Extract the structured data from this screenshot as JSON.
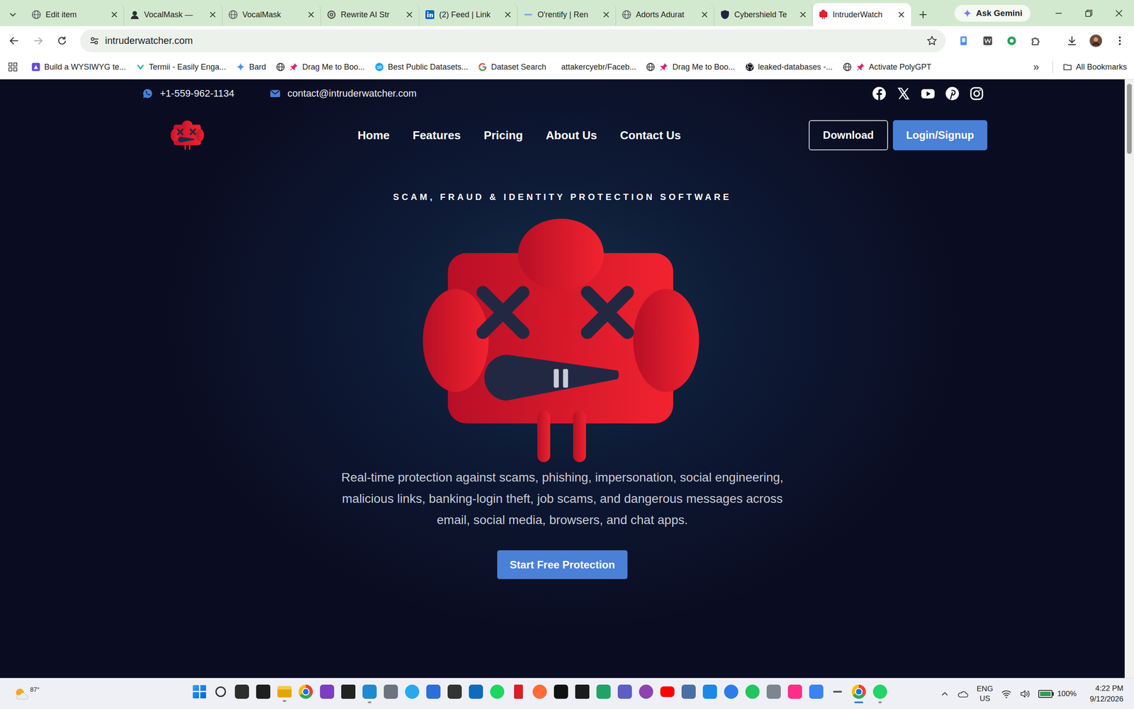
{
  "browser": {
    "nav": {
      "back_enabled": true,
      "forward_enabled": false
    },
    "tabs": [
      {
        "label": "Edit item",
        "selected": false,
        "kind": "globe"
      },
      {
        "label": "VocalMask —",
        "selected": false,
        "kind": "mask"
      },
      {
        "label": "VocalMask",
        "selected": false,
        "kind": "globe"
      },
      {
        "label": "Rewrite AI Str",
        "selected": false,
        "kind": "knot"
      },
      {
        "label": "(2) Feed | Link",
        "selected": false,
        "kind": "linkedin"
      },
      {
        "label": "O'rentify | Ren",
        "selected": false,
        "kind": "dash"
      },
      {
        "label": "Adorts Adurat",
        "selected": false,
        "kind": "globe"
      },
      {
        "label": "Cybershield Te",
        "selected": false,
        "kind": "shield"
      },
      {
        "label": "IntruderWatch",
        "selected": true,
        "kind": "intruder"
      }
    ],
    "gemini_button": "Ask Gemini",
    "address": "intruderwatcher.com",
    "starred": false,
    "bookmarks": [
      {
        "label": "Build a WYSIWYG te...",
        "kind": "wysiwyg"
      },
      {
        "label": "Termii - Easily Enga...",
        "kind": "termii"
      },
      {
        "label": "Bard",
        "kind": "bard"
      },
      {
        "label": "Drag Me to Boo...",
        "kind": "pinned"
      },
      {
        "label": "Best Public Datasets...",
        "kind": "datasets"
      },
      {
        "label": "Dataset Search",
        "kind": "google"
      },
      {
        "label": "attakercyebr/Faceb...",
        "kind": "none"
      },
      {
        "label": "Drag Me to Boo...",
        "kind": "pinned"
      },
      {
        "label": "leaked-databases -...",
        "kind": "github"
      },
      {
        "label": "Activate PolyGPT",
        "kind": "pinned"
      }
    ],
    "more_bookmarks": "»",
    "all_bookmarks": "All Bookmarks"
  },
  "page": {
    "phone": "+1-559-962-1134",
    "email": "contact@intruderwatcher.com",
    "nav": [
      "Home",
      "Features",
      "Pricing",
      "About Us",
      "Contact Us"
    ],
    "download_button": "Download",
    "login_button": "Login/Signup",
    "tagline": "SCAM, FRAUD & IDENTITY PROTECTION SOFTWARE",
    "video_playing": true,
    "description": "Real-time protection against scams, phishing, impersonation, social engineering, malicious links, banking-login theft, job scams, and dangerous messages across email, social media, browsers, and chat apps.",
    "cta": "Start Free Protection"
  },
  "taskbar": {
    "weather": "87°",
    "apps": [
      {
        "kind": "windows",
        "running": false,
        "active": false
      },
      {
        "kind": "search",
        "running": false,
        "active": false
      },
      {
        "kind": "taskview",
        "running": false,
        "active": false
      },
      {
        "kind": "terminal",
        "running": false,
        "active": false
      },
      {
        "kind": "explorer",
        "running": true,
        "active": false
      },
      {
        "kind": "chrome",
        "running": false,
        "active": false
      },
      {
        "kind": "onenote",
        "running": false,
        "active": false
      },
      {
        "kind": "hyper",
        "running": false,
        "active": false
      },
      {
        "kind": "vscode",
        "running": true,
        "active": false
      },
      {
        "kind": "camera",
        "running": false,
        "active": false
      },
      {
        "kind": "telegram",
        "running": false,
        "active": false
      },
      {
        "kind": "sharex",
        "running": false,
        "active": false
      },
      {
        "kind": "dots",
        "running": false,
        "active": false
      },
      {
        "kind": "outlook",
        "running": false,
        "active": false
      },
      {
        "kind": "spotify",
        "running": false,
        "active": false
      },
      {
        "kind": "netflix",
        "running": false,
        "active": false
      },
      {
        "kind": "postman",
        "running": false,
        "active": false
      },
      {
        "kind": "tiktok",
        "running": false,
        "active": false
      },
      {
        "kind": "console",
        "running": false,
        "active": false
      },
      {
        "kind": "sheets",
        "running": false,
        "active": false
      },
      {
        "kind": "teams",
        "running": false,
        "active": false
      },
      {
        "kind": "podcast",
        "running": false,
        "active": false
      },
      {
        "kind": "youtube",
        "running": false,
        "active": false
      },
      {
        "kind": "remote",
        "running": false,
        "active": false
      },
      {
        "kind": "store",
        "running": false,
        "active": false
      },
      {
        "kind": "todo",
        "running": false,
        "active": false
      },
      {
        "kind": "green",
        "running": false,
        "active": false
      },
      {
        "kind": "settings",
        "running": false,
        "active": false
      },
      {
        "kind": "capcut",
        "running": false,
        "active": false
      },
      {
        "kind": "photos",
        "running": false,
        "active": false
      },
      {
        "kind": "dash",
        "running": false,
        "active": false
      },
      {
        "kind": "chrome",
        "running": true,
        "active": true
      },
      {
        "kind": "whatsapp",
        "running": true,
        "active": false
      }
    ],
    "language": "ENG",
    "region": "US",
    "battery": "100%",
    "battery_level": 1,
    "time": "4:22 PM",
    "date": "9/12/2026"
  }
}
